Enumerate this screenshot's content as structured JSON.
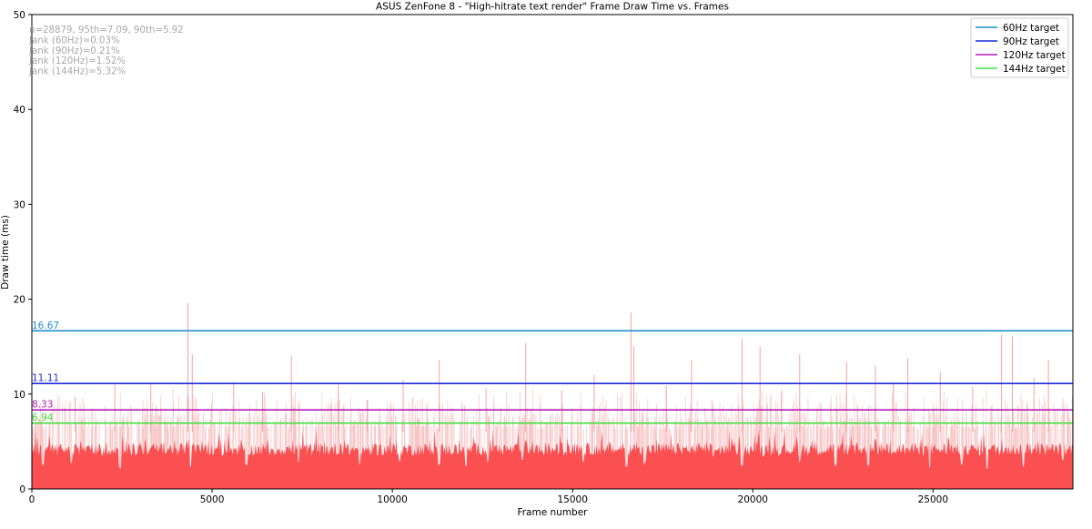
{
  "chart_data": {
    "type": "area",
    "title": "ASUS ZenFone 8 - \"High-hitrate text render\" Frame Draw Time vs. Frames",
    "xlabel": "Frame number",
    "ylabel": "Draw time (ms)",
    "xlim": [
      0,
      28879
    ],
    "ylim": [
      0,
      50
    ],
    "x_ticks": [
      0,
      5000,
      10000,
      15000,
      20000,
      25000
    ],
    "y_ticks": [
      0,
      10,
      20,
      30,
      40,
      50
    ],
    "grid": false,
    "legend_position": "top-right",
    "stats_lines": [
      "n=28879, 95th=7.09, 90th=5.92",
      "Jank (60Hz)=0.03%",
      "Jank (90Hz)=0.21%",
      "Jank (120Hz)=1.52%",
      "Jank (144Hz)=5.32%"
    ],
    "series": [
      {
        "kind": "frame_draw_time",
        "color": "#fa5052",
        "baseline_range_ms": [
          3.5,
          6.0
        ],
        "dips": [
          {
            "frame": 300,
            "value": 2.4
          },
          {
            "frame": 1100,
            "value": 2.6
          },
          {
            "frame": 2450,
            "value": 2.1
          },
          {
            "frame": 2900,
            "value": 3.4
          },
          {
            "frame": 3700,
            "value": 3.6
          },
          {
            "frame": 4400,
            "value": 2.2
          },
          {
            "frame": 5300,
            "value": 3.5
          },
          {
            "frame": 5950,
            "value": 2.2
          },
          {
            "frame": 6750,
            "value": 3.6
          },
          {
            "frame": 7400,
            "value": 2.7
          },
          {
            "frame": 8500,
            "value": 3.6
          },
          {
            "frame": 9100,
            "value": 2.3
          },
          {
            "frame": 9600,
            "value": 3.4
          },
          {
            "frame": 10200,
            "value": 2.6
          },
          {
            "frame": 11300,
            "value": 2.4
          },
          {
            "frame": 12050,
            "value": 2.1
          },
          {
            "frame": 12650,
            "value": 2.6
          },
          {
            "frame": 13600,
            "value": 2.9
          },
          {
            "frame": 14200,
            "value": 3.5
          },
          {
            "frame": 15300,
            "value": 2.7
          },
          {
            "frame": 16500,
            "value": 2.2
          },
          {
            "frame": 17000,
            "value": 2.5
          },
          {
            "frame": 18900,
            "value": 3.2
          },
          {
            "frame": 19700,
            "value": 2.4
          },
          {
            "frame": 20300,
            "value": 3.4
          },
          {
            "frame": 21300,
            "value": 2.7
          },
          {
            "frame": 22300,
            "value": 2.3
          },
          {
            "frame": 23200,
            "value": 2.4
          },
          {
            "frame": 24900,
            "value": 2.2
          },
          {
            "frame": 25800,
            "value": 2.5
          },
          {
            "frame": 26500,
            "value": 2.1
          },
          {
            "frame": 27500,
            "value": 2.3
          },
          {
            "frame": 28600,
            "value": 2.9
          }
        ],
        "spikes": [
          {
            "frame": 4330,
            "value": 19.6
          },
          {
            "frame": 4450,
            "value": 14.2
          },
          {
            "frame": 16620,
            "value": 18.6
          },
          {
            "frame": 16700,
            "value": 15.0
          },
          {
            "frame": 19700,
            "value": 15.8
          },
          {
            "frame": 20200,
            "value": 15.0
          },
          {
            "frame": 13700,
            "value": 15.4
          },
          {
            "frame": 7200,
            "value": 14.0
          },
          {
            "frame": 11300,
            "value": 13.6
          },
          {
            "frame": 26900,
            "value": 16.3
          },
          {
            "frame": 27200,
            "value": 16.1
          },
          {
            "frame": 21300,
            "value": 14.2
          },
          {
            "frame": 22600,
            "value": 13.4
          },
          {
            "frame": 23400,
            "value": 13.0
          },
          {
            "frame": 2300,
            "value": 11.0
          },
          {
            "frame": 3300,
            "value": 11.2
          },
          {
            "frame": 5600,
            "value": 11.3
          },
          {
            "frame": 8500,
            "value": 11.0
          },
          {
            "frame": 10300,
            "value": 11.5
          },
          {
            "frame": 15600,
            "value": 12.0
          },
          {
            "frame": 18300,
            "value": 13.6
          },
          {
            "frame": 24300,
            "value": 13.8
          },
          {
            "frame": 25200,
            "value": 12.3
          },
          {
            "frame": 28200,
            "value": 13.6
          },
          {
            "frame": 1200,
            "value": 9.7
          },
          {
            "frame": 6400,
            "value": 10.2
          },
          {
            "frame": 9300,
            "value": 9.4
          },
          {
            "frame": 12600,
            "value": 10.6
          },
          {
            "frame": 14700,
            "value": 10.4
          },
          {
            "frame": 17600,
            "value": 10.9
          },
          {
            "frame": 20800,
            "value": 10.4
          },
          {
            "frame": 23900,
            "value": 11.3
          },
          {
            "frame": 26100,
            "value": 10.8
          },
          {
            "frame": 27800,
            "value": 11.7
          }
        ]
      }
    ],
    "reference_lines": [
      {
        "name": "60Hz target",
        "value": 16.67,
        "label": "16.67",
        "color": "#1f8fd2"
      },
      {
        "name": "90Hz target",
        "value": 11.11,
        "label": "11.11",
        "color": "#1a2bd9"
      },
      {
        "name": "120Hz target",
        "value": 8.33,
        "label": "8.33",
        "color": "#b51ab5"
      },
      {
        "name": "144Hz target",
        "value": 6.94,
        "label": "6.94",
        "color": "#40e040"
      }
    ]
  }
}
